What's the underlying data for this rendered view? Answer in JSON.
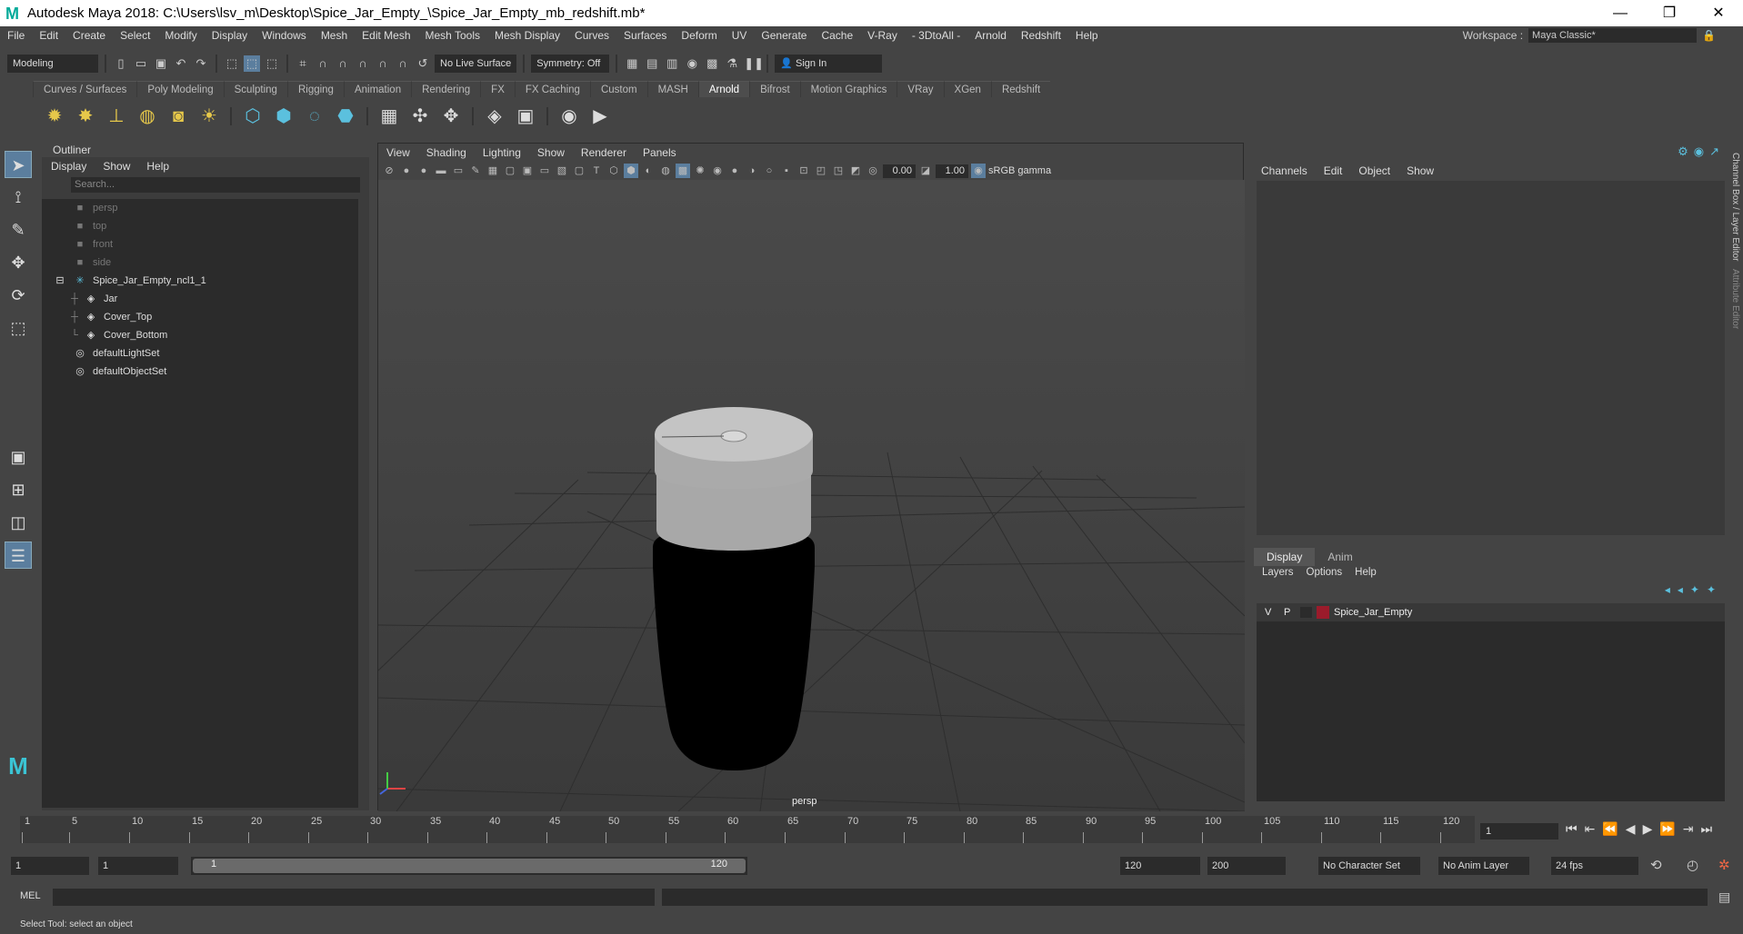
{
  "window": {
    "title": "Autodesk Maya 2018: C:\\Users\\lsv_m\\Desktop\\Spice_Jar_Empty_\\Spice_Jar_Empty_mb_redshift.mb*"
  },
  "menubar": {
    "items": [
      "File",
      "Edit",
      "Create",
      "Select",
      "Modify",
      "Display",
      "Windows",
      "Mesh",
      "Edit Mesh",
      "Mesh Tools",
      "Mesh Display",
      "Curves",
      "Surfaces",
      "Deform",
      "UV",
      "Generate",
      "Cache",
      "V-Ray",
      "- 3DtoAll -",
      "Arnold",
      "Redshift",
      "Help"
    ],
    "workspace_label": "Workspace :",
    "workspace_value": "Maya Classic*"
  },
  "statusline": {
    "mode": "Modeling",
    "live_surface": "No Live Surface",
    "symmetry": "Symmetry: Off",
    "sign_in": "Sign In"
  },
  "shelf": {
    "tabs": [
      "Curves / Surfaces",
      "Poly Modeling",
      "Sculpting",
      "Rigging",
      "Animation",
      "Rendering",
      "FX",
      "FX Caching",
      "Custom",
      "MASH",
      "Arnold",
      "Bifrost",
      "Motion Graphics",
      "VRay",
      "XGen",
      "Redshift"
    ],
    "active_tab": "Arnold"
  },
  "outliner": {
    "title": "Outliner",
    "menus": [
      "Display",
      "Show",
      "Help"
    ],
    "search_placeholder": "Search...",
    "items": [
      {
        "label": "persp",
        "icon": "camera-icon",
        "dim": true
      },
      {
        "label": "top",
        "icon": "camera-icon",
        "dim": true
      },
      {
        "label": "front",
        "icon": "camera-icon",
        "dim": true
      },
      {
        "label": "side",
        "icon": "camera-icon",
        "dim": true
      },
      {
        "label": "Spice_Jar_Empty_ncl1_1",
        "icon": "group-icon",
        "dim": false
      },
      {
        "label": "Jar",
        "icon": "mesh-icon",
        "dim": false
      },
      {
        "label": "Cover_Top",
        "icon": "mesh-icon",
        "dim": false
      },
      {
        "label": "Cover_Bottom",
        "icon": "mesh-icon",
        "dim": false
      },
      {
        "label": "defaultLightSet",
        "icon": "set-icon",
        "dim": false
      },
      {
        "label": "defaultObjectSet",
        "icon": "set-icon",
        "dim": false
      }
    ]
  },
  "viewport": {
    "menus": [
      "View",
      "Shading",
      "Lighting",
      "Show",
      "Renderer",
      "Panels"
    ],
    "exposure": "0.00",
    "gamma": "1.00",
    "color_space": "sRGB gamma",
    "camera_label": "persp"
  },
  "channelbox": {
    "menus": [
      "Channels",
      "Edit",
      "Object",
      "Show"
    ],
    "layer_tabs": [
      "Display",
      "Anim"
    ],
    "layer_menus": [
      "Layers",
      "Options",
      "Help"
    ],
    "layer": {
      "v": "V",
      "p": "P",
      "name": "Spice_Jar_Empty",
      "color": "#9b1b2b"
    },
    "vertical_tabs": [
      "Channel Box / Layer Editor",
      "Attribute Editor"
    ]
  },
  "timeline": {
    "ticks": [
      "1",
      "5",
      "10",
      "15",
      "20",
      "25",
      "30",
      "35",
      "40",
      "45",
      "50",
      "55",
      "60",
      "65",
      "70",
      "75",
      "80",
      "85",
      "90",
      "95",
      "100",
      "105",
      "110",
      "115",
      "120"
    ],
    "current_frame": "1"
  },
  "range": {
    "start": "1",
    "playback_start": "1",
    "slider_start": "1",
    "slider_end": "120",
    "playback_end": "120",
    "end": "200",
    "character_set": "No Character Set",
    "anim_layer": "No Anim Layer",
    "fps": "24 fps"
  },
  "command": {
    "label": "MEL",
    "help": "Select Tool: select an object"
  }
}
